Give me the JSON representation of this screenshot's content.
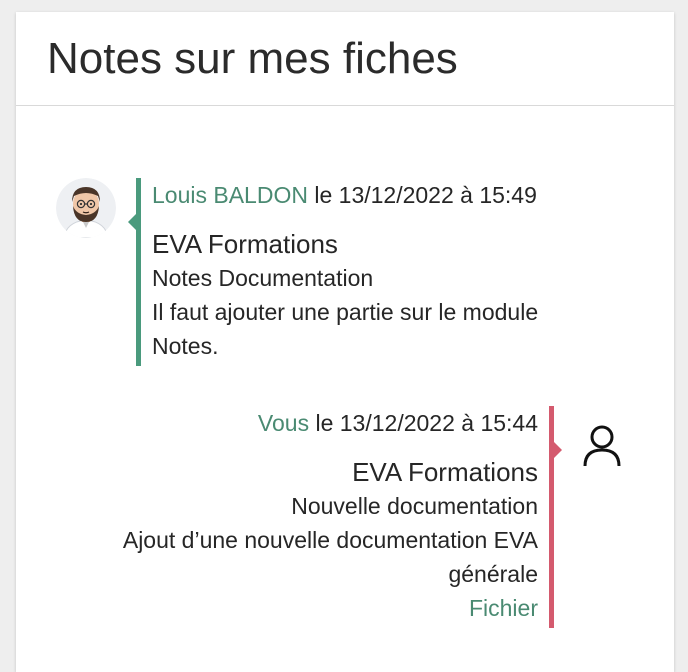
{
  "card": {
    "title": "Notes sur mes fiches"
  },
  "notes": [
    {
      "author": "Louis BALDON",
      "datetime": " le 13/12/2022 à 15:49",
      "title": "EVA Formations",
      "subtitle": "Notes Documentation",
      "body": "Il faut ajouter une partie sur le module Notes.",
      "avatar": "user-photo-avatar",
      "accent": "#4a9a7d"
    },
    {
      "author": "Vous",
      "datetime": " le 13/12/2022 à 15:44",
      "title": "EVA Formations",
      "subtitle": "Nouvelle documentation",
      "body": "Ajout d’une nouvelle documentation EVA générale",
      "attachment": "Fichier",
      "avatar": "user-outline-icon",
      "accent": "#d45a6e"
    }
  ]
}
